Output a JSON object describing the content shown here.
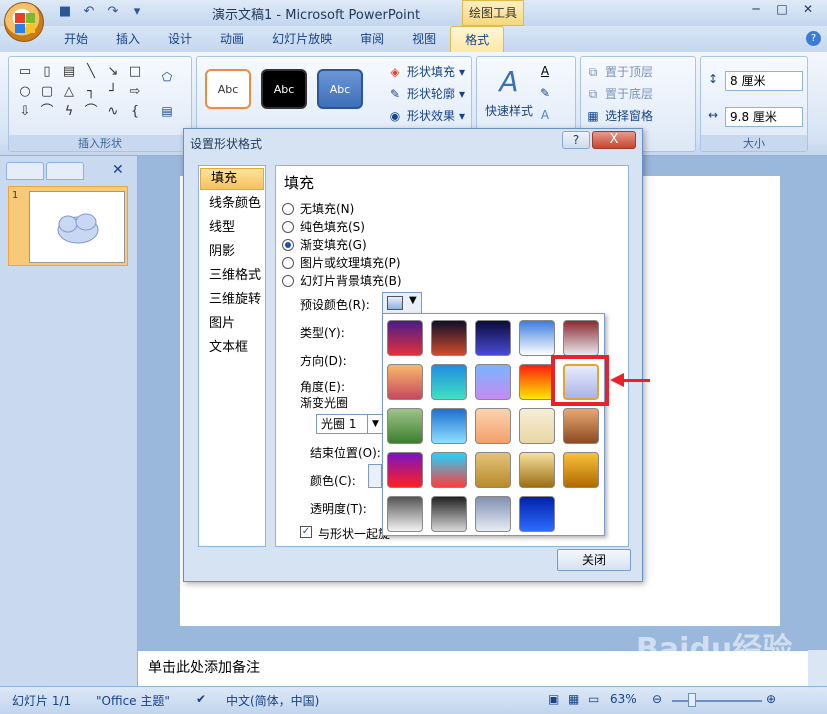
{
  "window": {
    "title": "演示文稿1 - Microsoft PowerPoint",
    "context_tools": "绘图工具"
  },
  "tabs": [
    "开始",
    "插入",
    "设计",
    "动画",
    "幻灯片放映",
    "审阅",
    "视图",
    "格式"
  ],
  "ribbon": {
    "insert_shapes_label": "插入形状",
    "style_boxes": [
      "Abc",
      "Abc",
      "Abc"
    ],
    "shape_fill": "形状填充",
    "shape_outline": "形状轮廓",
    "shape_effects": "形状效果",
    "quick_styles": "快速样式",
    "bring_front": "置于顶层",
    "send_back": "置于底层",
    "selection_pane": "选择窗格",
    "size_label": "大小",
    "height": "8 厘米",
    "width": "9.8 厘米"
  },
  "dialog": {
    "title": "设置形状格式",
    "help": "?",
    "close": "X",
    "categories": [
      "填充",
      "线条颜色",
      "线型",
      "阴影",
      "三维格式",
      "三维旋转",
      "图片",
      "文本框"
    ],
    "panel_title": "填充",
    "options": [
      "无填充(N)",
      "纯色填充(S)",
      "渐变填充(G)",
      "图片或纹理填充(P)",
      "幻灯片背景填充(B)"
    ],
    "selected_option": "渐变填充(G)",
    "preset_label": "预设颜色(R):",
    "type_label": "类型(Y):",
    "direction_label": "方向(D):",
    "angle_label": "角度(E):",
    "gradient_stops_label": "渐变光圈",
    "stop_value": "光圈 1",
    "end_position_label": "结束位置(O):",
    "color_label": "颜色(C):",
    "transparency_label": "透明度(T):",
    "rotate_with_shape": "与形状一起旋",
    "close_button": "关闭"
  },
  "slide_panel": {
    "slide_number": "1"
  },
  "notes_placeholder": "单击此处添加备注",
  "status": {
    "slide": "幻灯片 1/1",
    "theme": "\"Office 主题\"",
    "language": "中文(简体，中国)",
    "zoom": "63%"
  },
  "watermark": {
    "brand": "Baidu经验",
    "url": "jingyan.baidu.com"
  },
  "preset_gradients": [
    [
      "#4b1b8a",
      "#e2313b"
    ],
    [
      "#0f0f2a",
      "#d04b2b"
    ],
    [
      "#0b0b3a",
      "#4b4bd6"
    ],
    [
      "#3d7ee0",
      "#ffffff"
    ],
    [
      "#8a2a30",
      "#e8e8ec"
    ],
    [
      "#f6b96b",
      "#c7485e"
    ],
    [
      "#1f8de0",
      "#42e0c4"
    ],
    [
      "#7ab4ff",
      "#c48cf0"
    ],
    [
      "#ff1e0e",
      "#ffe700"
    ],
    [
      "#e8ecfb",
      "#a9b3ea"
    ],
    [
      "#9ec48a",
      "#3d7e2f"
    ],
    [
      "#1e6fd0",
      "#8fe0ff"
    ],
    [
      "#fbd3b0",
      "#f3a06a"
    ],
    [
      "#f7edd7",
      "#e8d6a4"
    ],
    [
      "#e8a872",
      "#8b4a21"
    ],
    [
      "#7a13c7",
      "#ff2020"
    ],
    [
      "#1fd4ff",
      "#ff3d3d"
    ],
    [
      "#e3c37a",
      "#b88a2a"
    ],
    [
      "#f6e0a0",
      "#9c6e12"
    ],
    [
      "#f9c13a",
      "#b06a00"
    ],
    [
      "#555555",
      "#f2f2f2"
    ],
    [
      "#222222",
      "#d8d8d8"
    ],
    [
      "#8090b0",
      "#e8edf5"
    ],
    [
      "#0022aa",
      "#2e6bff"
    ]
  ],
  "selected_preset_index": 9
}
